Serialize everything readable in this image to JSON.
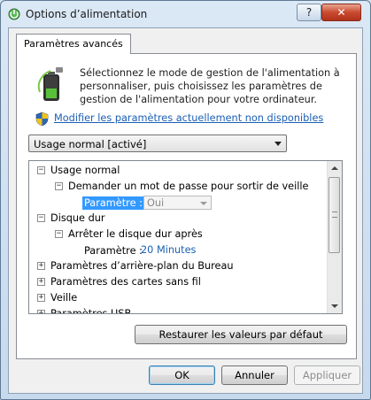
{
  "window": {
    "title": "Options d’alimentation",
    "help_label": "?",
    "close_label": "✕"
  },
  "tabs": [
    {
      "label": "Paramètres avancés"
    }
  ],
  "description": "Sélectionnez le mode de gestion de l'alimentation à personnaliser, puis choisissez les paramètres de gestion de l'alimentation pour votre ordinateur.",
  "link_label": "Modifier les paramètres actuellement non disponibles",
  "plan_select": {
    "value": "Usage normal [activé]"
  },
  "tree": {
    "root_label": "Usage normal",
    "password_item": "Demander un mot de passe pour sortir de veille",
    "password_param_label": "Paramètre :",
    "password_param_value": "Oui",
    "disk_label": "Disque dur",
    "disk_item": "Arrêter le disque dur après",
    "disk_param_label": "Paramètre :",
    "disk_param_value": "20 Minutes",
    "desktop_bg": "Paramètres d’arrière-plan du Bureau",
    "wireless": "Paramètres des cartes sans fil",
    "sleep": "Veille",
    "usb": "Paramètres USB",
    "expand_symbol": "+",
    "collapse_symbol": "−"
  },
  "buttons": {
    "restore": "Restaurer les valeurs par défaut",
    "ok": "OK",
    "cancel": "Annuler",
    "apply": "Appliquer"
  }
}
